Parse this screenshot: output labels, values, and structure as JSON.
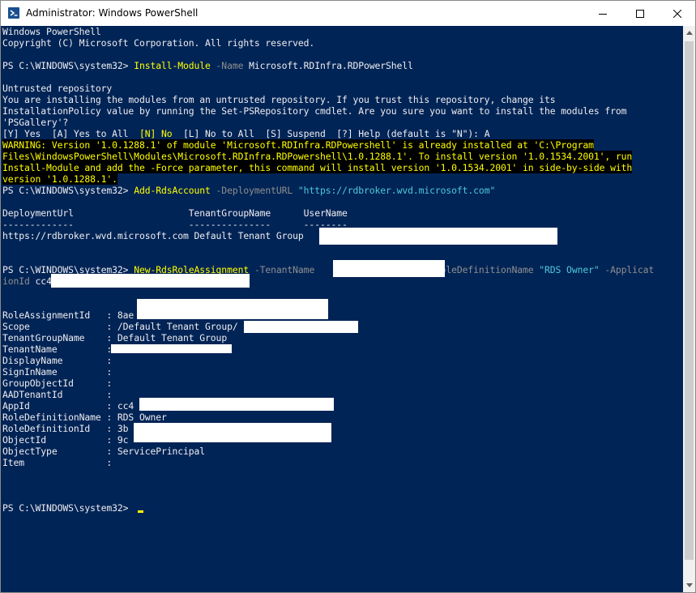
{
  "window": {
    "title": "Administrator: Windows PowerShell",
    "icon": "powershell-icon",
    "controls": {
      "minimize": "minimize-icon",
      "maximize": "maximize-icon",
      "close": "close-icon"
    }
  },
  "colors": {
    "console_bg": "#012456",
    "text": "#eeedf0",
    "command": "#ffff00",
    "parameter": "#8f8f8f",
    "string": "#4ec9d8",
    "warning_fg": "#ffff00",
    "warning_bg": "#000000"
  },
  "console": {
    "banner_1": "Windows PowerShell",
    "banner_2": "Copyright (C) Microsoft Corporation. All rights reserved.",
    "prompt": "PS C:\\WINDOWS\\system32> ",
    "cmd1": {
      "command": "Install-Module",
      "param": " -Name",
      "arg": " Microsoft.RDInfra.RDPowerShell"
    },
    "untrusted_1": "Untrusted repository",
    "untrusted_2": "You are installing the modules from an untrusted repository. If you trust this repository, change its",
    "untrusted_3": "InstallationPolicy value by running the Set-PSRepository cmdlet. Are you sure you want to install the modules from",
    "untrusted_4": "'PSGallery'?",
    "choices": {
      "part1": "[Y] Yes  [A] Yes to All  ",
      "default": "[N] No",
      "part2": "  [L] No to All  [S] Suspend  [?] Help (default is \"N\"): A"
    },
    "warning": [
      "WARNING: Version '1.0.1288.1' of module 'Microsoft.RDInfra.RDPowershell' is already installed at 'C:\\Program",
      "Files\\WindowsPowerShell\\Modules\\Microsoft.RDInfra.RDPowershell\\1.0.1288.1'. To install version '1.0.1534.2001', run",
      "Install-Module and add the -Force parameter, this command will install version '1.0.1534.2001' in side-by-side with",
      "version '1.0.1288.1'."
    ],
    "cmd2": {
      "command": "Add-RdsAccount",
      "param": " -DeploymentURL",
      "arg": " \"https://rdbroker.wvd.microsoft.com\""
    },
    "table": {
      "headers": "DeploymentUrl                     TenantGroupName      UserName",
      "underline": "-------------                     ---------------      --------",
      "row": "https://rdbroker.wvd.microsoft.com Default Tenant Group"
    },
    "cmd3": {
      "command": "New-RdsRoleAssignment",
      "param1": " -TenantName",
      "param2": " -RoleDefinitionName",
      "arg2": " \"RDS Owner\"",
      "param3": " -Applicat",
      "wrap_param": "ionId",
      "wrap_arg": " cc4"
    },
    "result": [
      {
        "key": "RoleAssignmentId   : ",
        "value": "8ae"
      },
      {
        "key": "Scope              : ",
        "value": "/Default Tenant Group/"
      },
      {
        "key": "TenantGroupName    : ",
        "value": "Default Tenant Group"
      },
      {
        "key": "TenantName         : ",
        "value": ""
      },
      {
        "key": "DisplayName        : ",
        "value": ""
      },
      {
        "key": "SignInName         : ",
        "value": ""
      },
      {
        "key": "GroupObjectId      : ",
        "value": ""
      },
      {
        "key": "AADTenantId        : ",
        "value": ""
      },
      {
        "key": "AppId              : ",
        "value": "cc4"
      },
      {
        "key": "RoleDefinitionName : ",
        "value": "RDS Owner"
      },
      {
        "key": "RoleDefinitionId   : ",
        "value": "3b"
      },
      {
        "key": "ObjectId           : ",
        "value": "9c"
      },
      {
        "key": "ObjectType         : ",
        "value": "ServicePrincipal"
      },
      {
        "key": "Item               : ",
        "value": ""
      }
    ],
    "final_prompt": "PS C:\\WINDOWS\\system32> "
  }
}
